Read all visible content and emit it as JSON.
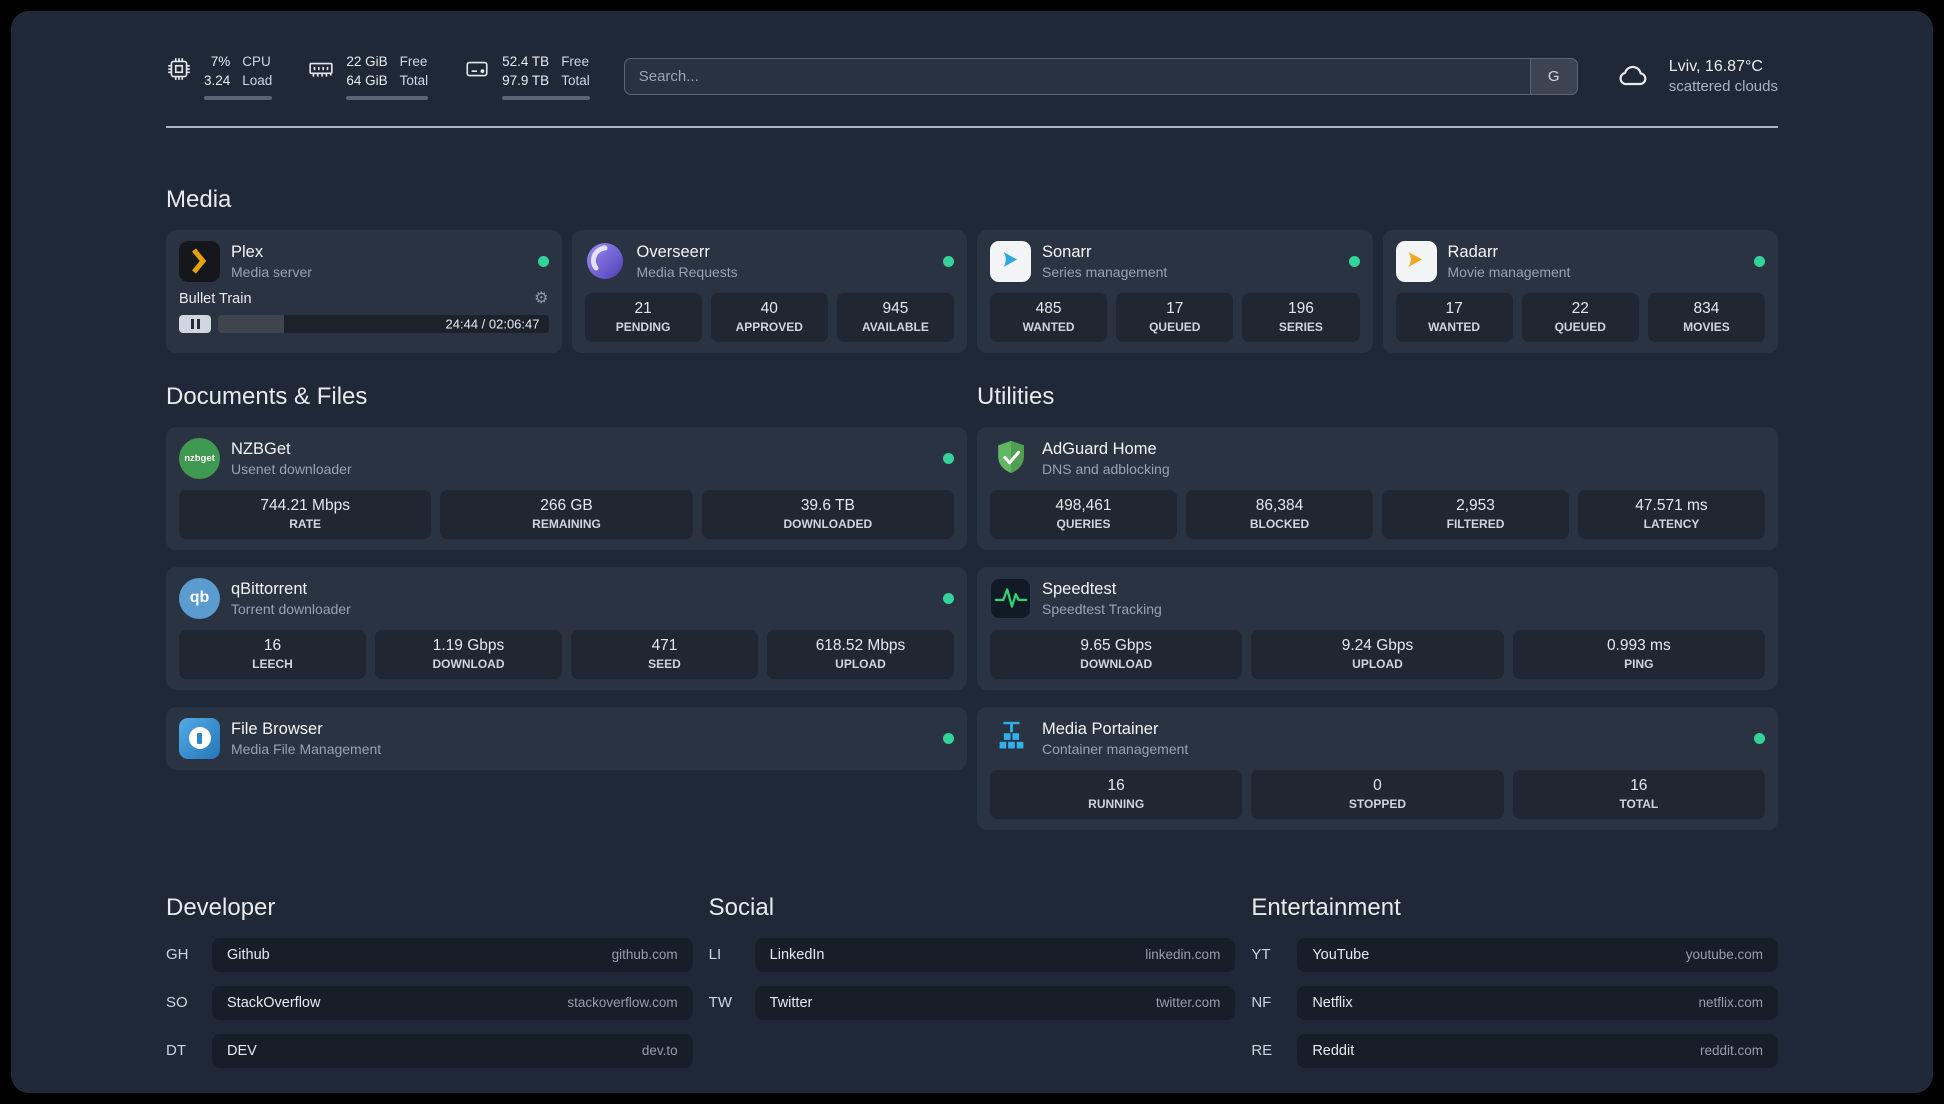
{
  "colors": {
    "accent_green": "#34d399",
    "background": "#1e2836",
    "plex_amber": "#e5a00d",
    "adguard_green": "#63b663",
    "portainer_blue": "#2fb1ec"
  },
  "topbar": {
    "resources": [
      {
        "icon": "cpu-icon",
        "values": [
          "7%",
          "3.24"
        ],
        "labels": [
          "CPU",
          "Load"
        ],
        "bar_pct": 7
      },
      {
        "icon": "memory-icon",
        "values": [
          "22 GiB",
          "64 GiB"
        ],
        "labels": [
          "Free",
          "Total"
        ],
        "bar_pct": 66
      },
      {
        "icon": "disk-icon",
        "values": [
          "52.4 TB",
          "97.9 TB"
        ],
        "labels": [
          "Free",
          "Total"
        ],
        "bar_pct": 47
      }
    ],
    "search": {
      "placeholder": "Search...",
      "button_label": "G"
    },
    "weather": {
      "location": "Lviv, 16.87°C",
      "condition": "scattered clouds"
    }
  },
  "sections": {
    "media": {
      "title": "Media",
      "cards": [
        {
          "name": "Plex",
          "desc": "Media server",
          "online": true,
          "player": {
            "track": "Bullet Train",
            "time": "24:44 / 02:06:47",
            "progress_pct": 20
          }
        },
        {
          "name": "Overseerr",
          "desc": "Media Requests",
          "online": true,
          "stats": [
            {
              "value": "21",
              "label": "PENDING"
            },
            {
              "value": "40",
              "label": "APPROVED"
            },
            {
              "value": "945",
              "label": "AVAILABLE"
            }
          ]
        },
        {
          "name": "Sonarr",
          "desc": "Series management",
          "online": true,
          "stats": [
            {
              "value": "485",
              "label": "WANTED"
            },
            {
              "value": "17",
              "label": "QUEUED"
            },
            {
              "value": "196",
              "label": "SERIES"
            }
          ]
        },
        {
          "name": "Radarr",
          "desc": "Movie management",
          "online": true,
          "stats": [
            {
              "value": "17",
              "label": "WANTED"
            },
            {
              "value": "22",
              "label": "QUEUED"
            },
            {
              "value": "834",
              "label": "MOVIES"
            }
          ]
        }
      ]
    },
    "files": {
      "title": "Documents & Files",
      "cards": [
        {
          "name": "NZBGet",
          "desc": "Usenet downloader",
          "online": true,
          "stats": [
            {
              "value": "744.21 Mbps",
              "label": "RATE"
            },
            {
              "value": "266 GB",
              "label": "REMAINING"
            },
            {
              "value": "39.6 TB",
              "label": "DOWNLOADED"
            }
          ]
        },
        {
          "name": "qBittorrent",
          "desc": "Torrent downloader",
          "online": true,
          "stats": [
            {
              "value": "16",
              "label": "LEECH"
            },
            {
              "value": "1.19 Gbps",
              "label": "DOWNLOAD"
            },
            {
              "value": "471",
              "label": "SEED"
            },
            {
              "value": "618.52 Mbps",
              "label": "UPLOAD"
            }
          ]
        },
        {
          "name": "File Browser",
          "desc": "Media File Management",
          "online": true
        }
      ]
    },
    "utilities": {
      "title": "Utilities",
      "cards": [
        {
          "name": "AdGuard Home",
          "desc": "DNS and adblocking",
          "online": false,
          "stats": [
            {
              "value": "498,461",
              "label": "QUERIES"
            },
            {
              "value": "86,384",
              "label": "BLOCKED"
            },
            {
              "value": "2,953",
              "label": "FILTERED"
            },
            {
              "value": "47.571 ms",
              "label": "LATENCY"
            }
          ]
        },
        {
          "name": "Speedtest",
          "desc": "Speedtest Tracking",
          "online": false,
          "stats": [
            {
              "value": "9.65 Gbps",
              "label": "DOWNLOAD"
            },
            {
              "value": "9.24 Gbps",
              "label": "UPLOAD"
            },
            {
              "value": "0.993 ms",
              "label": "PING"
            }
          ]
        },
        {
          "name": "Media Portainer",
          "desc": "Container management",
          "online": true,
          "stats": [
            {
              "value": "16",
              "label": "RUNNING"
            },
            {
              "value": "0",
              "label": "STOPPED"
            },
            {
              "value": "16",
              "label": "TOTAL"
            }
          ]
        }
      ]
    }
  },
  "bookmarks": {
    "groups": [
      {
        "title": "Developer",
        "items": [
          {
            "abbr": "GH",
            "name": "Github",
            "url": "github.com"
          },
          {
            "abbr": "SO",
            "name": "StackOverflow",
            "url": "stackoverflow.com"
          },
          {
            "abbr": "DT",
            "name": "DEV",
            "url": "dev.to"
          }
        ]
      },
      {
        "title": "Social",
        "items": [
          {
            "abbr": "LI",
            "name": "LinkedIn",
            "url": "linkedin.com"
          },
          {
            "abbr": "TW",
            "name": "Twitter",
            "url": "twitter.com"
          }
        ]
      },
      {
        "title": "Entertainment",
        "items": [
          {
            "abbr": "YT",
            "name": "YouTube",
            "url": "youtube.com"
          },
          {
            "abbr": "NF",
            "name": "Netflix",
            "url": "netflix.com"
          },
          {
            "abbr": "RE",
            "name": "Reddit",
            "url": "reddit.com"
          }
        ]
      }
    ]
  }
}
